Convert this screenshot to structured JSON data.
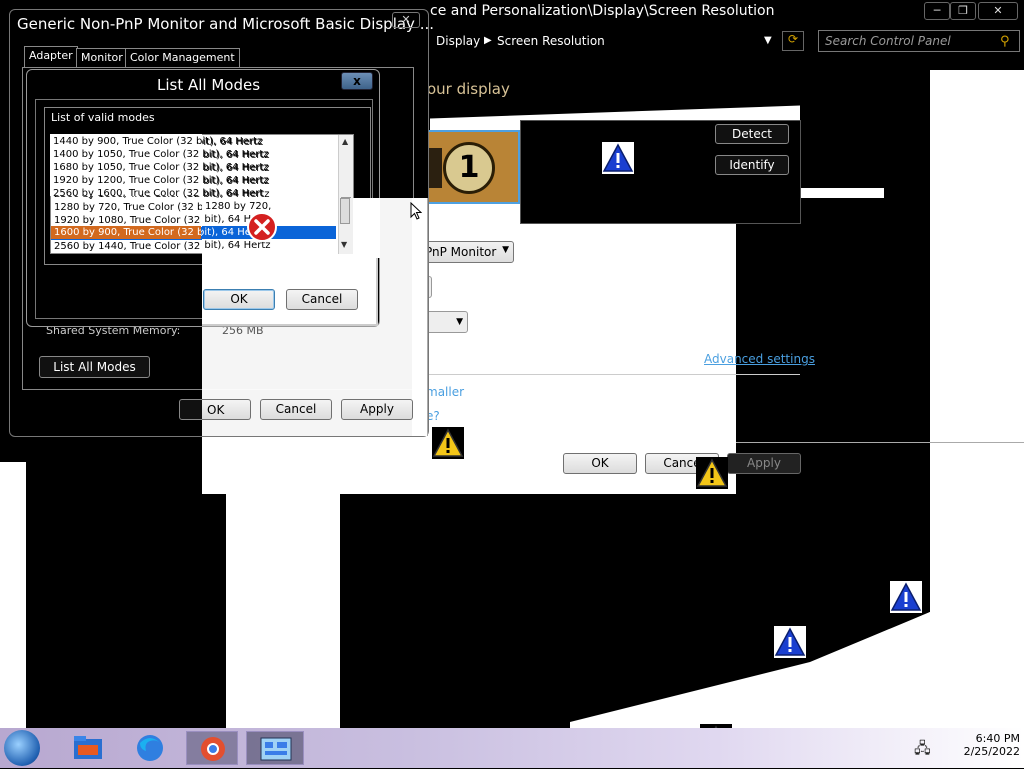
{
  "control_panel": {
    "title": "ce and Personalization\\Display\\Screen Resolution",
    "window_buttons": [
      "minimize-icon",
      "maximize-icon",
      "close-icon"
    ],
    "breadcrumb": [
      "Display",
      "Screen Resolution"
    ],
    "search_placeholder": "Search Control Panel",
    "heading": "our display",
    "detect_label": "Detect",
    "identify_label": "Identify",
    "monitor_number": "1",
    "display_select": "PnP Monitor",
    "advanced_link": "Advanced settings",
    "smaller_link": "maller",
    "other_link": "e?",
    "ok_label": "OK",
    "cancel_label": "Cance",
    "apply_label": "Apply"
  },
  "properties": {
    "title": "Generic Non-PnP Monitor and Microsoft Basic Display ...",
    "close_label": "✕",
    "tabs": [
      "Adapter",
      "Monitor",
      "Color Management"
    ],
    "shared_memory_label": "Shared System Memory:",
    "shared_memory_value": "256 MB",
    "list_all_modes_label": "List All Modes",
    "ok_label": "OK",
    "cancel_label": "Cancel",
    "apply_label": "Apply"
  },
  "list_modes": {
    "title": "List All Modes",
    "close_label": "x",
    "legend": "List of valid modes",
    "modes": [
      "1440 by 900, True Color (32 bit), 64 Hertz",
      "1400 by 1050, True Color (32 bit), 64 Hertz",
      "1680 by 1050, True Color (32 bit), 64 Hertz",
      "1920 by 1200, True Color (32 bit), 64 Hertz",
      "2560 by 1600, True Color (32 bit), 64 Hertz",
      "1280 by 720, True Color (32 bit), 64 Hertz",
      "1920 by 1080, True Color (32 bit), 64 Hertz",
      "1600 by 900, True Color (32 bit), 64 Hertz",
      "2560 by 1440, True Color (32 bit), 64 Hertz"
    ],
    "selected_index": 7,
    "ok_label": "OK",
    "cancel_label": "Cancel"
  },
  "taskbar": {
    "time": "6:40 PM",
    "date": "2/25/2022"
  },
  "colors": {
    "selection": "#0a64d8",
    "link": "#4a9fe0",
    "heading": "#d7c296"
  }
}
